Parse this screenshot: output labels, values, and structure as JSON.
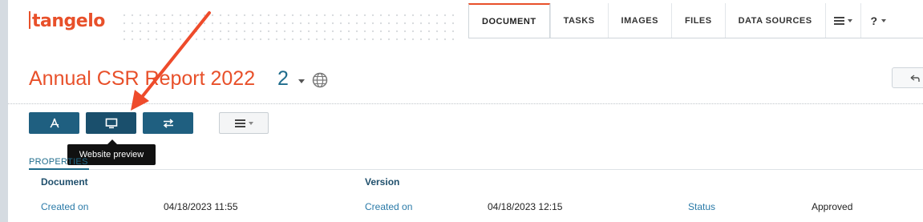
{
  "app": {
    "logo": "tangelo"
  },
  "tabs": [
    {
      "label": "DOCUMENT",
      "active": true
    },
    {
      "label": "TASKS"
    },
    {
      "label": "IMAGES"
    },
    {
      "label": "FILES"
    },
    {
      "label": "DATA SOURCES"
    }
  ],
  "tab_menu_icon": "hamburger-icon",
  "tab_help": {
    "label": "?"
  },
  "document": {
    "title": "Annual CSR Report 2022",
    "version": "2",
    "globe_icon": "globe-icon",
    "back_icon": "back-arrow-icon"
  },
  "toolbar": {
    "pdf_icon": "pdf-icon",
    "preview_icon": "monitor-icon",
    "compare_icon": "swap-arrows-icon",
    "more_icon": "hamburger-icon",
    "tooltip": "Website preview"
  },
  "properties": {
    "tab_label": "PROPERTIES",
    "document_section": {
      "heading": "Document",
      "created_on_label": "Created on",
      "created_on_value": "04/18/2023 11:55"
    },
    "version_section": {
      "heading": "Version",
      "created_on_label": "Created on",
      "created_on_value": "04/18/2023 12:15",
      "status_label": "Status",
      "status_value": "Approved"
    }
  },
  "colors": {
    "brand": "#e8502a",
    "primary": "#1f5f80",
    "link": "#2a7aa8",
    "annotation_arrow": "#ee4b2b"
  }
}
